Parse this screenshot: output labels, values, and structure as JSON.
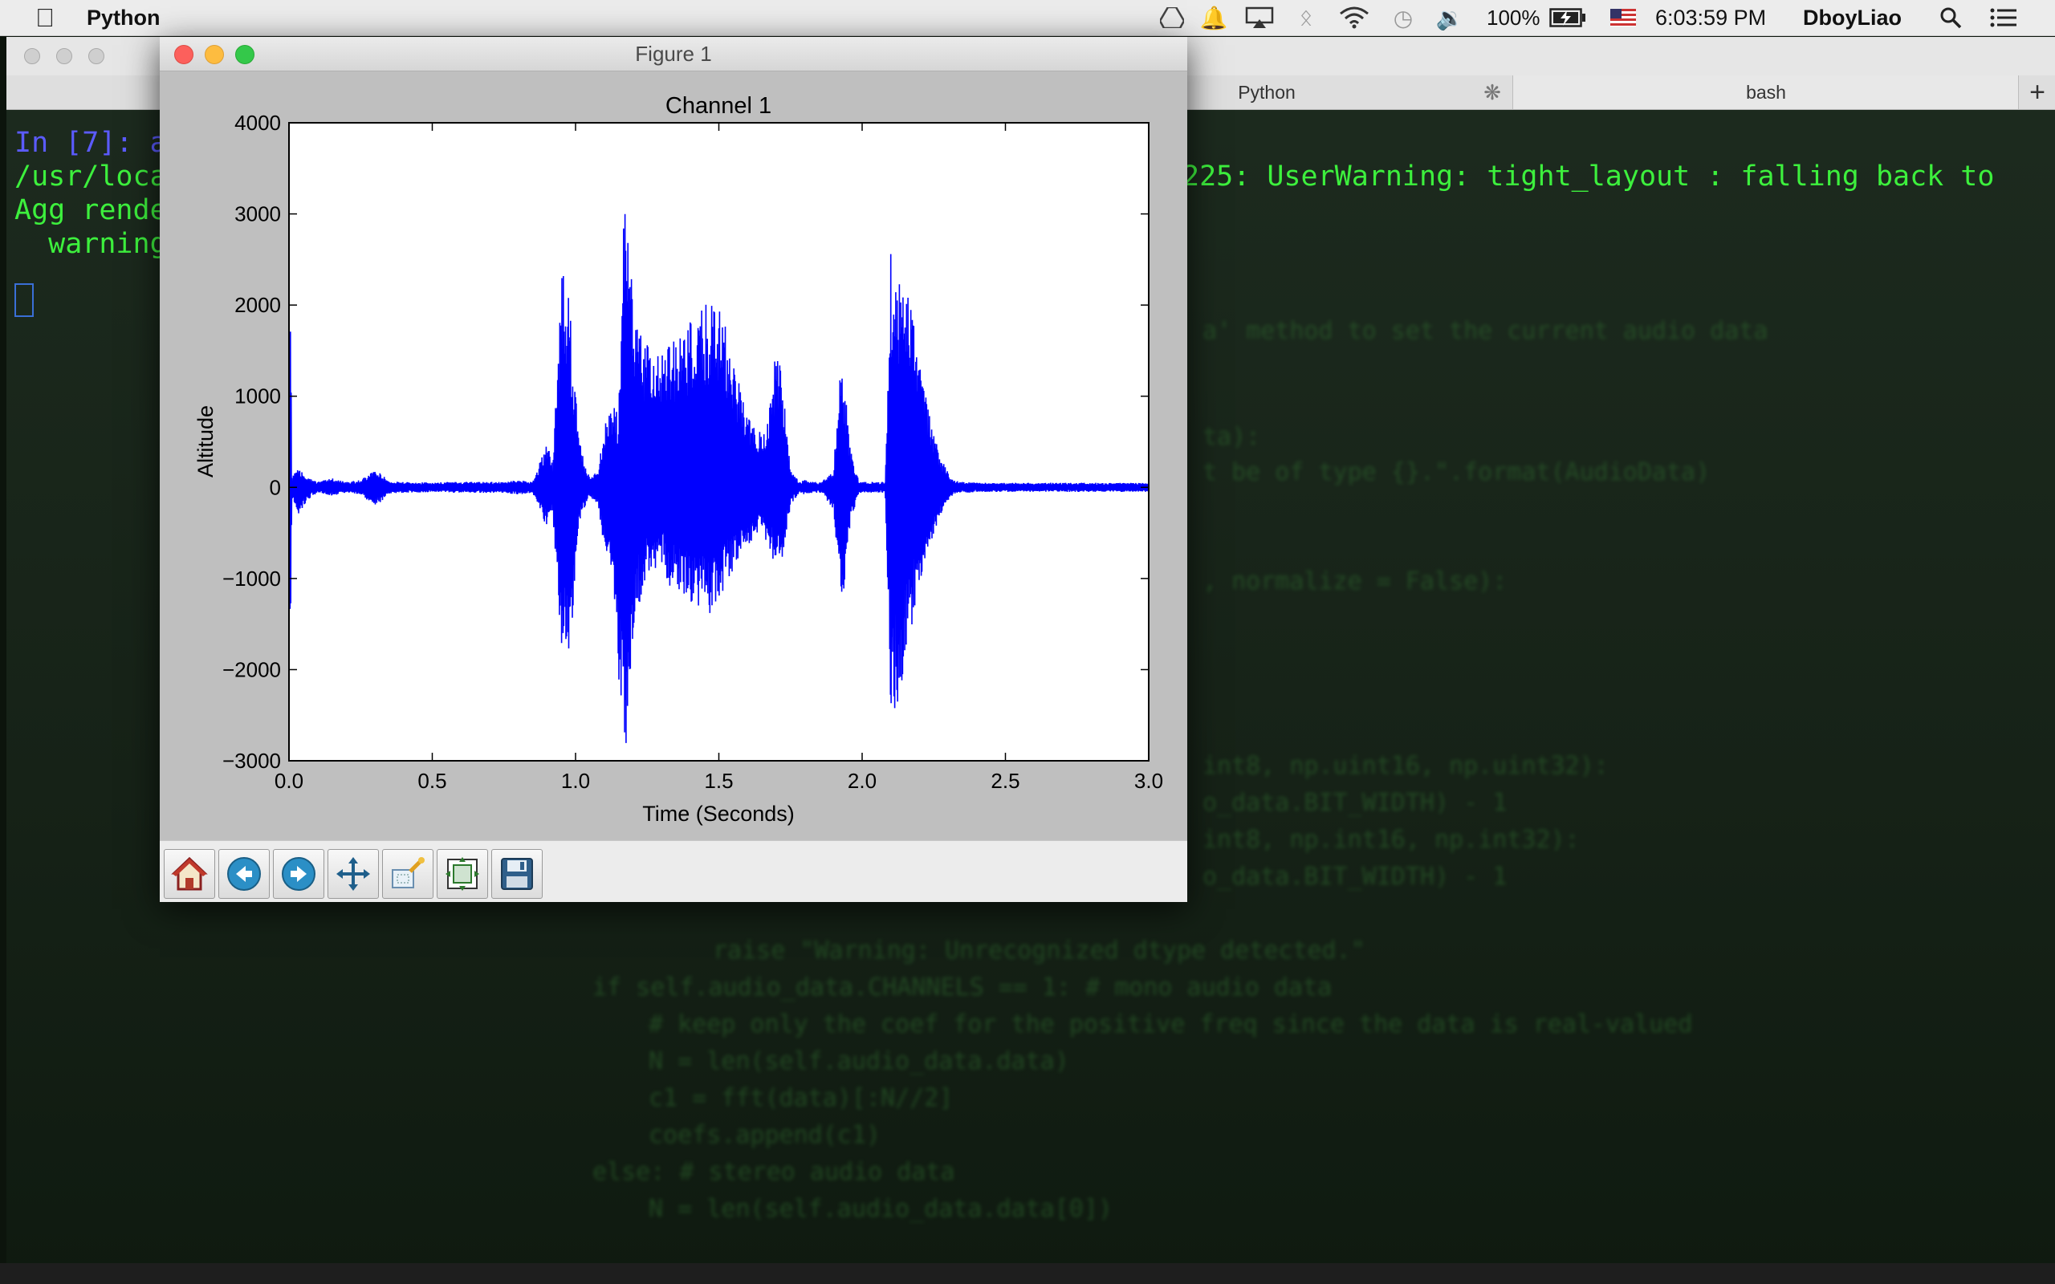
{
  "menubar": {
    "app_name": "Python",
    "battery": "100%",
    "clock": "6:03:59 PM",
    "user": "DboyLiao"
  },
  "terminal": {
    "tabs": [
      "Python",
      "bash"
    ],
    "lines": [
      {
        "text": "In [7]: a",
        "color": "#5b5bff"
      },
      {
        "text": "/usr/loca",
        "color": "#3df03d"
      },
      {
        "text": "Agg rende",
        "color": "#3df03d"
      },
      {
        "text": "  warning",
        "color": "#3df03d"
      }
    ],
    "warning_tail": "225: UserWarning: tight_layout : falling back to"
  },
  "figure": {
    "window_title": "Figure 1",
    "toolbar": [
      "home-icon",
      "back-icon",
      "forward-icon",
      "pan-icon",
      "zoom-icon",
      "subplots-icon",
      "save-icon"
    ]
  },
  "chart_data": {
    "type": "line",
    "title": "Channel 1",
    "xlabel": "Time (Seconds)",
    "ylabel": "Altitude",
    "xlim": [
      0.0,
      3.0
    ],
    "ylim": [
      -3000,
      4000
    ],
    "xticks": [
      "0.0",
      "0.5",
      "1.0",
      "1.5",
      "2.0",
      "2.5",
      "3.0"
    ],
    "yticks": [
      "4000",
      "3000",
      "2000",
      "1000",
      "0",
      "−1000",
      "−2000",
      "−3000"
    ],
    "xtick_values": [
      0.0,
      0.5,
      1.0,
      1.5,
      2.0,
      2.5,
      3.0
    ],
    "ytick_values": [
      4000,
      3000,
      2000,
      1000,
      0,
      -1000,
      -2000,
      -3000
    ],
    "grid": false,
    "color": "#0000ff",
    "series": [
      {
        "x": [
          0.0,
          0.005,
          0.01,
          0.03,
          0.08,
          0.1,
          0.15,
          0.2,
          0.25,
          0.3,
          0.35,
          0.4,
          0.45,
          0.5,
          0.55,
          0.6,
          0.65,
          0.7,
          0.75,
          0.8,
          0.85,
          0.9,
          0.92,
          0.95,
          0.97,
          0.99,
          1.0,
          1.02,
          1.05,
          1.08,
          1.1,
          1.13,
          1.15,
          1.17,
          1.18,
          1.19,
          1.2,
          1.22,
          1.25,
          1.28,
          1.3,
          1.33,
          1.36,
          1.4,
          1.43,
          1.46,
          1.49,
          1.52,
          1.55,
          1.58,
          1.61,
          1.64,
          1.67,
          1.7,
          1.72,
          1.75,
          1.78,
          1.8,
          1.83,
          1.86,
          1.9,
          1.93,
          1.96,
          1.99,
          2.02,
          2.05,
          2.08,
          2.1,
          2.13,
          2.15,
          2.17,
          2.19,
          2.21,
          2.23,
          2.25,
          2.28,
          2.31,
          2.34,
          2.37,
          2.4,
          2.45,
          2.5,
          2.55,
          2.6,
          2.65,
          2.7,
          2.75,
          2.8,
          2.85,
          2.9,
          2.95,
          3.0
        ],
        "y_max": [
          60,
          2380,
          120,
          200,
          90,
          60,
          100,
          60,
          80,
          200,
          70,
          60,
          60,
          50,
          60,
          60,
          60,
          60,
          60,
          80,
          60,
          500,
          250,
          2300,
          2400,
          1500,
          1000,
          400,
          100,
          200,
          700,
          900,
          800,
          3400,
          3000,
          2600,
          2100,
          1800,
          1600,
          1500,
          1550,
          1650,
          1750,
          1850,
          1900,
          2050,
          2000,
          1850,
          1450,
          1100,
          800,
          600,
          700,
          1600,
          1300,
          200,
          60,
          80,
          60,
          60,
          200,
          1500,
          400,
          60,
          60,
          60,
          60,
          2600,
          2400,
          2200,
          2000,
          1600,
          1200,
          900,
          600,
          300,
          100,
          60,
          60,
          50,
          50,
          50,
          50,
          50,
          50,
          50,
          50,
          50,
          50,
          50,
          50,
          50
        ],
        "y_min": [
          -60,
          -2200,
          -150,
          -300,
          -100,
          -60,
          -90,
          -60,
          -80,
          -220,
          -70,
          -60,
          -60,
          -50,
          -60,
          -60,
          -60,
          -60,
          -60,
          -80,
          -60,
          -450,
          -250,
          -1800,
          -2050,
          -1400,
          -900,
          -300,
          -100,
          -200,
          -700,
          -900,
          -2100,
          -2900,
          -2750,
          -2300,
          -1800,
          -1300,
          -1000,
          -900,
          -850,
          -1100,
          -1150,
          -1250,
          -1300,
          -1400,
          -1350,
          -1100,
          -900,
          -700,
          -600,
          -500,
          -600,
          -900,
          -800,
          -200,
          -60,
          -80,
          -60,
          -60,
          -250,
          -1300,
          -400,
          -60,
          -60,
          -60,
          -60,
          -2600,
          -2300,
          -1900,
          -1600,
          -1300,
          -1000,
          -700,
          -500,
          -250,
          -100,
          -60,
          -60,
          -50,
          -50,
          -50,
          -50,
          -50,
          -50,
          -50,
          -50,
          -50,
          -50,
          -50,
          -50,
          -50
        ]
      }
    ]
  }
}
